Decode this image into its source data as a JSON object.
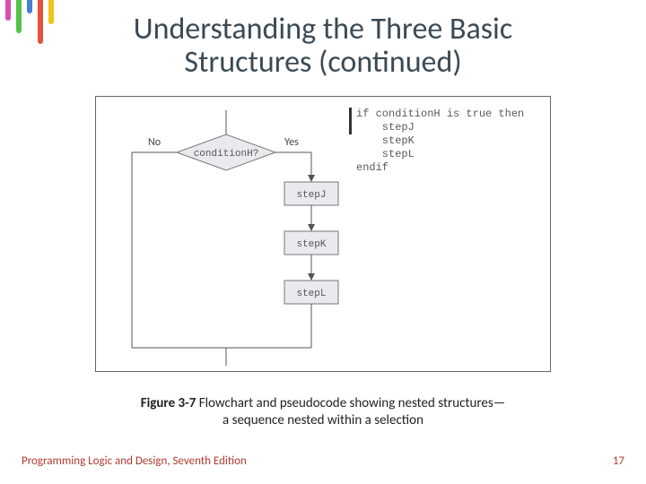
{
  "title_line1": "Understanding the Three Basic",
  "title_line2": "Structures (continued)",
  "flowchart": {
    "no_label": "No",
    "yes_label": "Yes",
    "decision": "conditionH?",
    "stepJ": "stepJ",
    "stepK": "stepK",
    "stepL": "stepL"
  },
  "pseudocode": {
    "l1": "if conditionH is true then",
    "l2": "    stepJ",
    "l3": "    stepK",
    "l4": "    stepL",
    "l5": "endif"
  },
  "caption": {
    "lead": "Figure 3-7",
    "rest_line1": " Flowchart and pseudocode showing nested structures—",
    "rest_line2": "a sequence nested within a selection"
  },
  "footer": {
    "left": "Programming Logic and Design, Seventh Edition",
    "right": "17"
  }
}
